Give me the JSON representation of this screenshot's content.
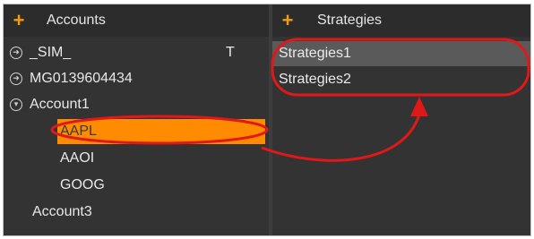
{
  "accounts_panel": {
    "title": "Accounts",
    "rows": [
      {
        "label": "_SIM_",
        "flag": "T"
      },
      {
        "label": "MG0139604434"
      },
      {
        "label": "Account1"
      },
      {
        "label": "AAPL"
      },
      {
        "label": "AAOI"
      },
      {
        "label": "GOOG"
      },
      {
        "label": "Account3"
      }
    ]
  },
  "strategies_panel": {
    "title": "Strategies",
    "items": [
      {
        "label": "Strategies1"
      },
      {
        "label": "Strategies2"
      }
    ]
  },
  "colors": {
    "accent": "#ff8c00",
    "annotation": "#e01818",
    "panel_bg": "#333333"
  }
}
